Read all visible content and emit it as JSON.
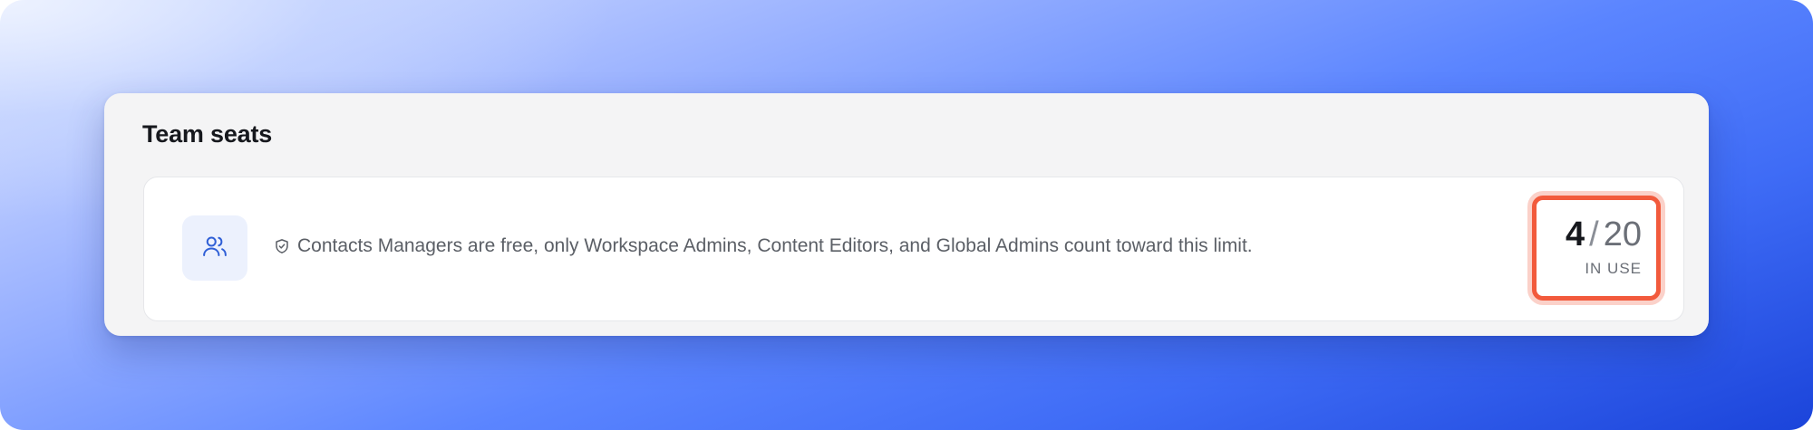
{
  "panel": {
    "title": "Team seats"
  },
  "seats": {
    "icon": "users-icon",
    "info_icon": "shield-check-icon",
    "info_text": "Contacts Managers are free, only Workspace Admins, Content Editors, and Global Admins count toward this limit.",
    "used": "4",
    "separator": "/",
    "total": "20",
    "usage_label": "IN USE"
  },
  "colors": {
    "highlight": "#f25a3c",
    "icon_blue": "#2f5fd6",
    "badge_bg": "#ecf1fd"
  }
}
